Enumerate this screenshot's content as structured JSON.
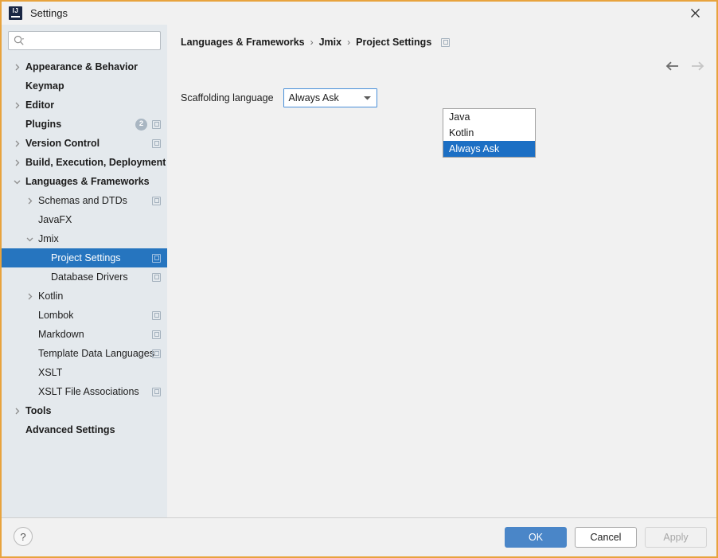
{
  "window": {
    "title": "Settings",
    "logo_icon": "intellij-idea-logo",
    "close_icon": "close-icon"
  },
  "sidebar": {
    "search": {
      "placeholder": "",
      "value": "",
      "icon": "search-icon"
    },
    "items": [
      {
        "label": "Appearance & Behavior",
        "indent": 0,
        "bold": true,
        "chevron": "right",
        "badge": null,
        "panel_icon": false,
        "selected": false
      },
      {
        "label": "Keymap",
        "indent": 0,
        "bold": true,
        "chevron": null,
        "badge": null,
        "panel_icon": false,
        "selected": false
      },
      {
        "label": "Editor",
        "indent": 0,
        "bold": true,
        "chevron": "right",
        "badge": null,
        "panel_icon": false,
        "selected": false
      },
      {
        "label": "Plugins",
        "indent": 0,
        "bold": true,
        "chevron": null,
        "badge": "2",
        "panel_icon": true,
        "selected": false
      },
      {
        "label": "Version Control",
        "indent": 0,
        "bold": true,
        "chevron": "right",
        "badge": null,
        "panel_icon": true,
        "selected": false
      },
      {
        "label": "Build, Execution, Deployment",
        "indent": 0,
        "bold": true,
        "chevron": "right",
        "badge": null,
        "panel_icon": false,
        "selected": false
      },
      {
        "label": "Languages & Frameworks",
        "indent": 0,
        "bold": true,
        "chevron": "down",
        "badge": null,
        "panel_icon": false,
        "selected": false
      },
      {
        "label": "Schemas and DTDs",
        "indent": 1,
        "bold": false,
        "chevron": "right",
        "badge": null,
        "panel_icon": true,
        "selected": false
      },
      {
        "label": "JavaFX",
        "indent": 1,
        "bold": false,
        "chevron": null,
        "badge": null,
        "panel_icon": false,
        "selected": false
      },
      {
        "label": "Jmix",
        "indent": 1,
        "bold": false,
        "chevron": "down",
        "badge": null,
        "panel_icon": false,
        "selected": false
      },
      {
        "label": "Project Settings",
        "indent": 2,
        "bold": false,
        "chevron": null,
        "badge": null,
        "panel_icon": true,
        "selected": true
      },
      {
        "label": "Database Drivers",
        "indent": 2,
        "bold": false,
        "chevron": null,
        "badge": null,
        "panel_icon": true,
        "selected": false
      },
      {
        "label": "Kotlin",
        "indent": 1,
        "bold": false,
        "chevron": "right",
        "badge": null,
        "panel_icon": false,
        "selected": false
      },
      {
        "label": "Lombok",
        "indent": 1,
        "bold": false,
        "chevron": null,
        "badge": null,
        "panel_icon": true,
        "selected": false
      },
      {
        "label": "Markdown",
        "indent": 1,
        "bold": false,
        "chevron": null,
        "badge": null,
        "panel_icon": true,
        "selected": false
      },
      {
        "label": "Template Data Languages",
        "indent": 1,
        "bold": false,
        "chevron": null,
        "badge": null,
        "panel_icon": true,
        "selected": false
      },
      {
        "label": "XSLT",
        "indent": 1,
        "bold": false,
        "chevron": null,
        "badge": null,
        "panel_icon": false,
        "selected": false
      },
      {
        "label": "XSLT File Associations",
        "indent": 1,
        "bold": false,
        "chevron": null,
        "badge": null,
        "panel_icon": true,
        "selected": false
      },
      {
        "label": "Tools",
        "indent": 0,
        "bold": true,
        "chevron": "right",
        "badge": null,
        "panel_icon": false,
        "selected": false
      },
      {
        "label": "Advanced Settings",
        "indent": 0,
        "bold": true,
        "chevron": null,
        "badge": null,
        "panel_icon": false,
        "selected": false
      }
    ]
  },
  "content": {
    "breadcrumb": [
      "Languages & Frameworks",
      "Jmix",
      "Project Settings"
    ],
    "breadcrumb_separator": "›",
    "breadcrumb_icon": "panel-icon",
    "nav": {
      "back_icon": "arrow-left-icon",
      "forward_icon": "arrow-right-icon",
      "back_enabled": true,
      "forward_enabled": false
    },
    "form": {
      "label": "Scaffolding language",
      "combo": {
        "value": "Always Ask",
        "arrow_icon": "chevron-down-icon",
        "expanded": true,
        "options": [
          "Java",
          "Kotlin",
          "Always Ask"
        ],
        "selected_option": "Always Ask"
      }
    }
  },
  "footer": {
    "help_label": "?",
    "help_icon": "help-icon",
    "ok_label": "OK",
    "cancel_label": "Cancel",
    "apply_label": "Apply",
    "apply_enabled": false
  },
  "colors": {
    "frame_border": "#e8a33d",
    "sidebar_bg": "#e4e9ed",
    "content_bg": "#f1f1f1",
    "selection_blue": "#2675bf",
    "dropdown_selection_blue": "#1c6fc4",
    "primary_button": "#4a86c8",
    "focus_border": "#4a90d9"
  }
}
